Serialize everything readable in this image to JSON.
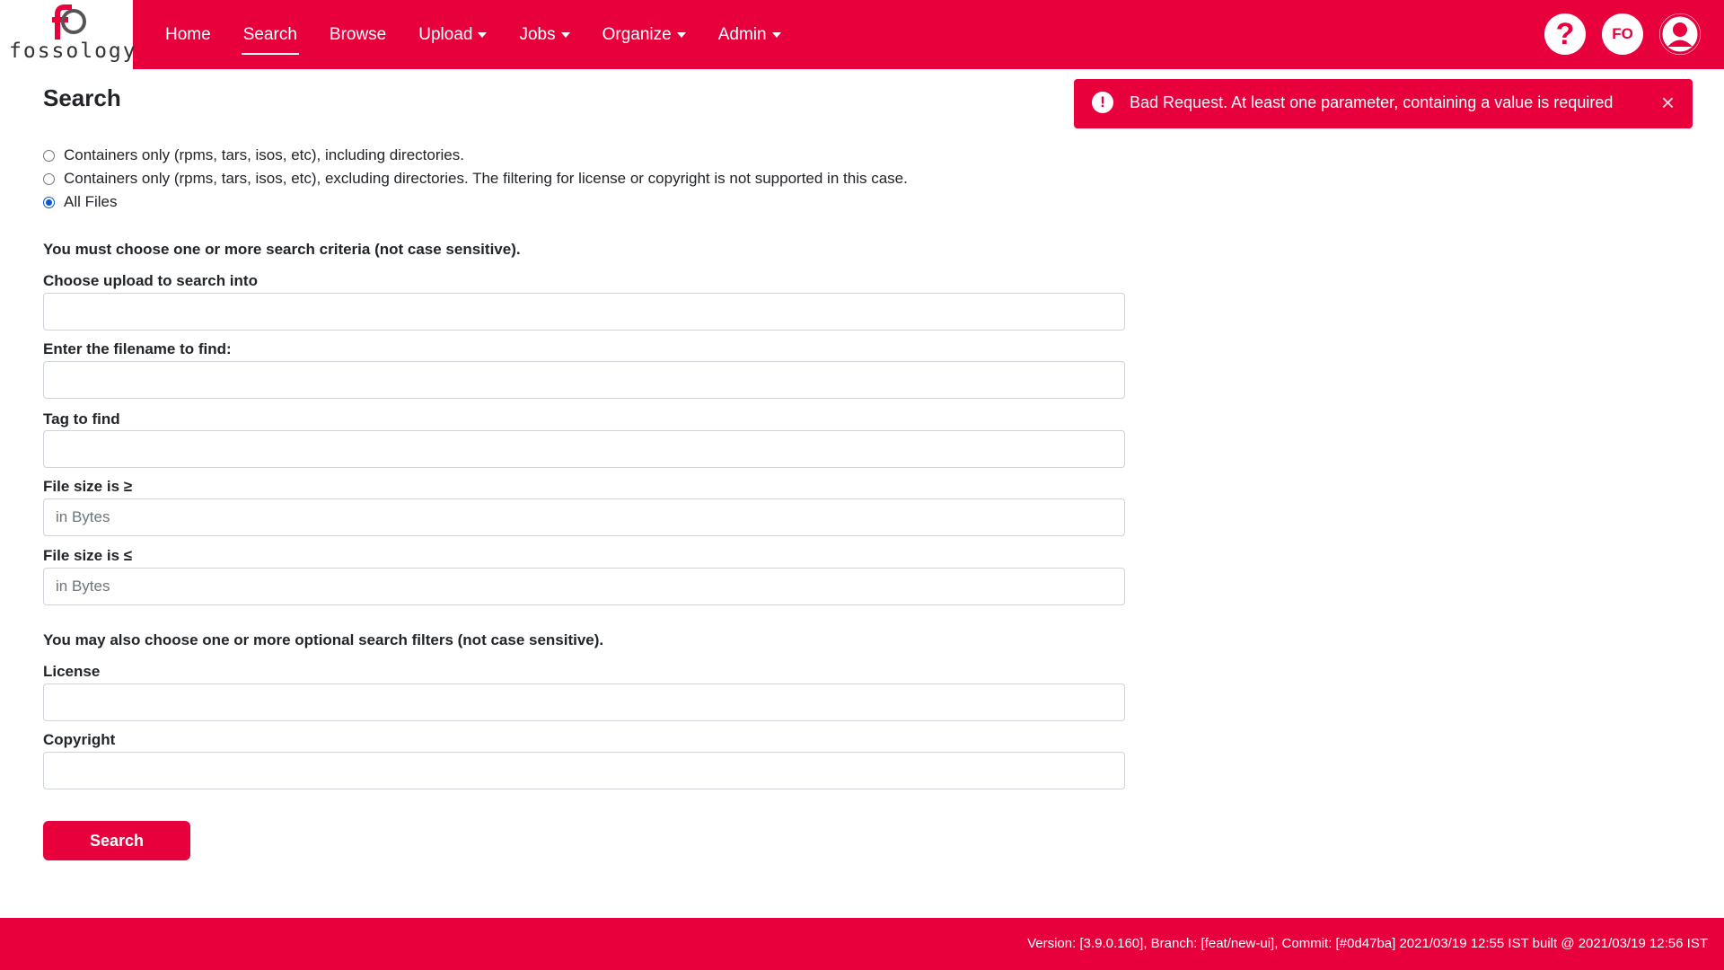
{
  "brand": {
    "name": "fossology",
    "mark_text": "FO",
    "primary_color": "#e8003d"
  },
  "nav": {
    "items": [
      {
        "label": "Home",
        "dropdown": false
      },
      {
        "label": "Search",
        "dropdown": false,
        "active": true
      },
      {
        "label": "Browse",
        "dropdown": false
      },
      {
        "label": "Upload",
        "dropdown": true
      },
      {
        "label": "Jobs",
        "dropdown": true
      },
      {
        "label": "Organize",
        "dropdown": true
      },
      {
        "label": "Admin",
        "dropdown": true
      }
    ],
    "right": {
      "help_icon": "question-circle-icon",
      "user_initials": "FO",
      "user_icon": "user-circle-icon"
    }
  },
  "page": {
    "title": "Search",
    "scope_options": [
      {
        "label": "Containers only (rpms, tars, isos, etc), including directories.",
        "checked": false
      },
      {
        "label": "Containers only (rpms, tars, isos, etc), excluding directories. The filtering for license or copyright is not supported in this case.",
        "checked": false
      },
      {
        "label": "All Files",
        "checked": true
      }
    ],
    "criteria_note": "You must choose one or more search criteria (not case sensitive).",
    "fields": {
      "upload": {
        "label": "Choose upload to search into",
        "value": "",
        "placeholder": ""
      },
      "filename": {
        "label": "Enter the filename to find:",
        "value": "",
        "placeholder": ""
      },
      "tag": {
        "label": "Tag to find",
        "value": "",
        "placeholder": ""
      },
      "size_min": {
        "label": "File size is ≥",
        "value": "",
        "placeholder": "in Bytes"
      },
      "size_max": {
        "label": "File size is ≤",
        "value": "",
        "placeholder": "in Bytes"
      },
      "license": {
        "label": "License",
        "value": "",
        "placeholder": ""
      },
      "copyright": {
        "label": "Copyright",
        "value": "",
        "placeholder": ""
      }
    },
    "filters_note": "You may also choose one or more optional search filters (not case sensitive).",
    "search_button": "Search"
  },
  "alert": {
    "icon": "exclamation-circle-icon",
    "message": "Bad Request. At least one parameter, containing a value is required",
    "close": "×"
  },
  "footer": {
    "text": "Version: [3.9.0.160], Branch: [feat/new-ui], Commit: [#0d47ba] 2021/03/19 12:55 IST built @ 2021/03/19 12:56 IST"
  }
}
